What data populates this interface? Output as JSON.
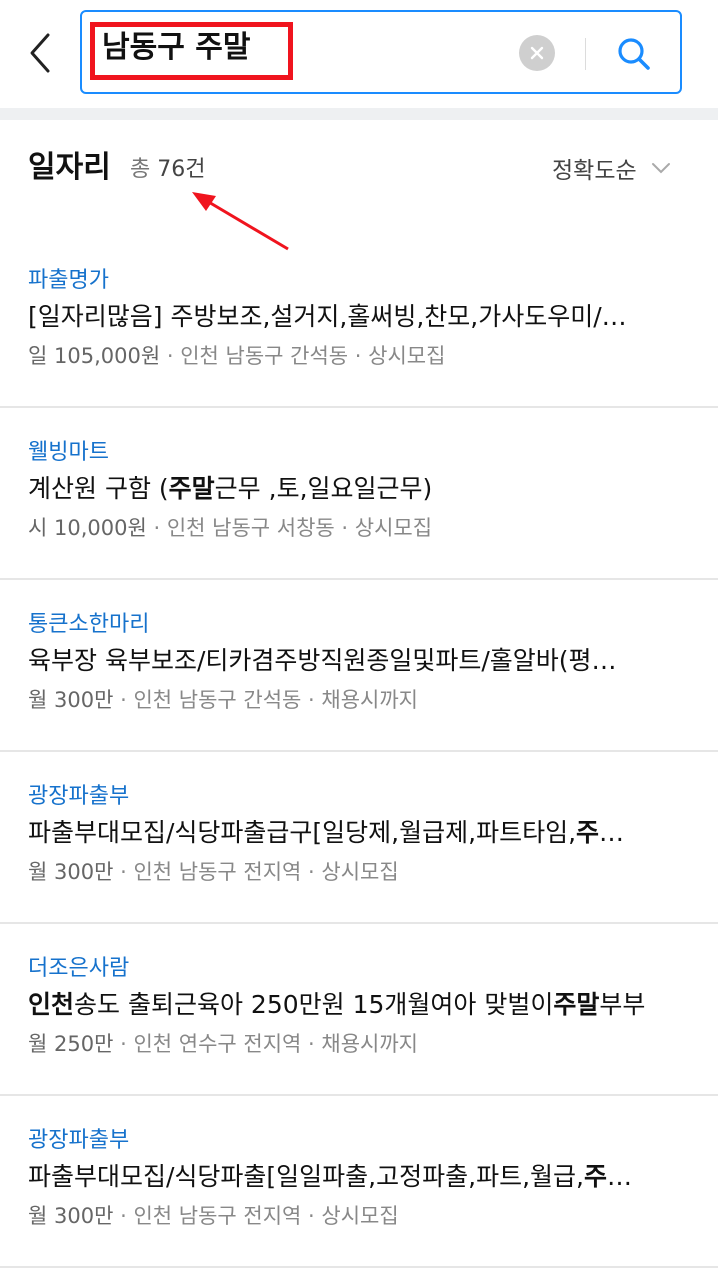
{
  "search": {
    "query": "남동구 주말"
  },
  "section": {
    "title": "일자리",
    "count_label": "총",
    "count_value": "76건",
    "sort_label": "정확도순"
  },
  "jobs": [
    {
      "company": "파출명가",
      "title_parts": [
        [
          "[일자리많음] 주방보조,설거지,홀써빙,찬모,가사도우미/…",
          false
        ]
      ],
      "pay": "일 105,000원",
      "location": "인천 남동구 간석동",
      "deadline": "상시모집"
    },
    {
      "company": "웰빙마트",
      "title_parts": [
        [
          "계산원 구함 (",
          false
        ],
        [
          "주말",
          true
        ],
        [
          "근무 ,토,일요일근무)",
          false
        ]
      ],
      "pay": "시 10,000원",
      "location": "인천 남동구 서창동",
      "deadline": "상시모집"
    },
    {
      "company": "통큰소한마리",
      "title_parts": [
        [
          "육부장 육부보조/티카겸주방직원종일및파트/홀알바(평…",
          false
        ]
      ],
      "pay": "월 300만",
      "location": "인천 남동구 간석동",
      "deadline": "채용시까지"
    },
    {
      "company": "광장파출부",
      "title_parts": [
        [
          "파출부대모집/식당파출급구[일당제,월급제,파트타임,",
          false
        ],
        [
          "주",
          true
        ],
        [
          "…",
          false
        ]
      ],
      "pay": "월 300만",
      "location": "인천 남동구 전지역",
      "deadline": "상시모집"
    },
    {
      "company": "더조은사람",
      "title_parts": [
        [
          "인천",
          true
        ],
        [
          "송도 출퇴근육아 250만원 15개월여아 맞벌이",
          false
        ],
        [
          "주말",
          true
        ],
        [
          "부부",
          false
        ]
      ],
      "pay": "월 250만",
      "location": "인천 연수구 전지역",
      "deadline": "채용시까지"
    },
    {
      "company": "광장파출부",
      "title_parts": [
        [
          "파출부대모집/식당파출[일일파출,고정파출,파트,월급,",
          false
        ],
        [
          "주",
          true
        ],
        [
          "…",
          false
        ]
      ],
      "pay": "월 300만",
      "location": "인천 남동구 전지역",
      "deadline": "상시모집"
    }
  ],
  "icons": {
    "back": "back-chevron-icon",
    "clear": "clear-icon",
    "search": "search-icon",
    "sort": "chevron-down-icon"
  },
  "colors": {
    "accent": "#1a8cff",
    "company": "#1672cc",
    "highlight": "#f0141e"
  }
}
